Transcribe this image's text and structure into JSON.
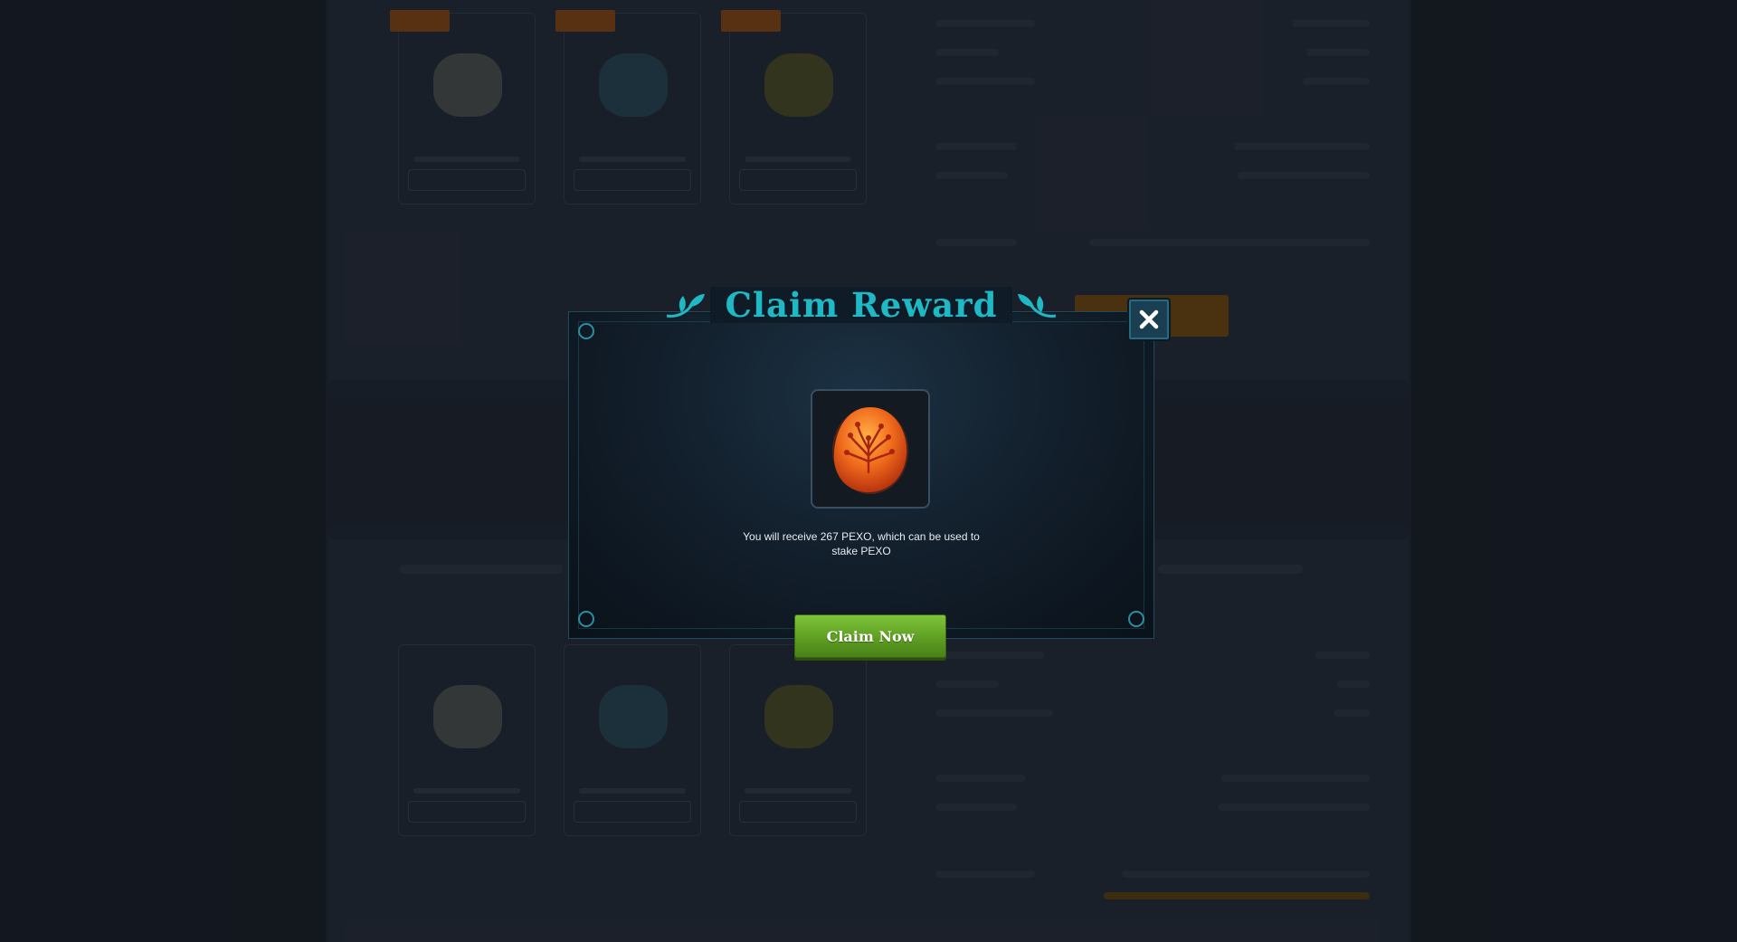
{
  "modal": {
    "title": "Claim Reward",
    "message": "You will receive 267 PEXO, which can be used to stake PEXO",
    "claim_label": "Claim Now",
    "close_icon": "close-icon",
    "reward_icon": "pexo-egg-icon"
  },
  "colors": {
    "title": "#1fb9c6",
    "claim_button": "#6fb22e",
    "modal_border": "#1f4d5e",
    "overlay": "#141821"
  }
}
